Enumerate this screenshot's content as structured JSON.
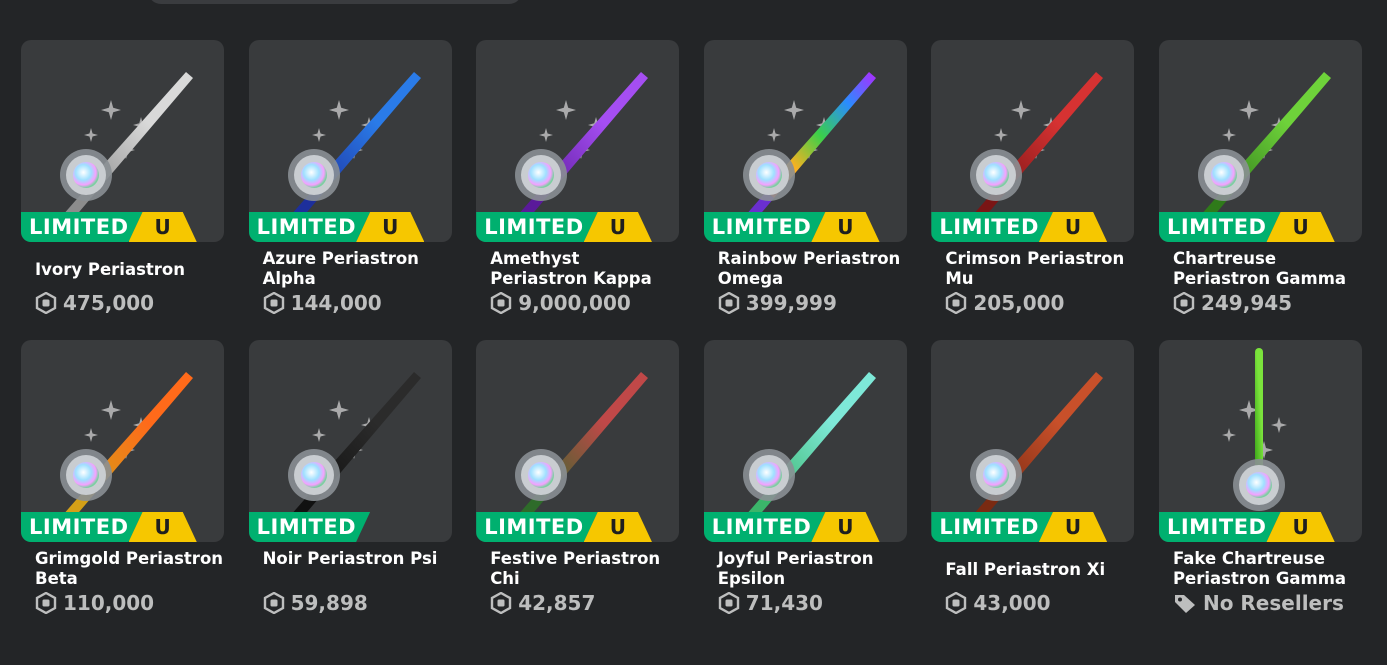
{
  "badges": {
    "limited": "LIMITED",
    "unique": "U"
  },
  "items": [
    {
      "name": "Ivory Periastron",
      "price": "475,000",
      "color": "#d9d9d9",
      "dark": "#8c8c8c",
      "limited_u": true,
      "sparkles": true
    },
    {
      "name": "Azure Periastron Alpha",
      "price": "144,000",
      "color": "#2a7be8",
      "dark": "#1d2f9c",
      "limited_u": true,
      "sparkles": true
    },
    {
      "name": "Amethyst Periastron Kappa",
      "price": "9,000,000",
      "color": "#a54ef2",
      "dark": "#5a1a9a",
      "limited_u": true,
      "sparkles": true
    },
    {
      "name": "Rainbow Periastron Omega",
      "price": "399,999",
      "color": "rainbow",
      "dark": "#6a2fd0",
      "limited_u": true,
      "sparkles": true
    },
    {
      "name": "Crimson Periastron Mu",
      "price": "205,000",
      "color": "#d63232",
      "dark": "#7a1515",
      "limited_u": true,
      "sparkles": true
    },
    {
      "name": "Chartreuse Periastron Gamma",
      "price": "249,945",
      "color": "#6ed23a",
      "dark": "#2f7a1a",
      "limited_u": true,
      "sparkles": true
    },
    {
      "name": "Grimgold Periastron Beta",
      "price": "110,000",
      "color": "#ff6a1a",
      "dark": "#d4a017",
      "limited_u": true,
      "sparkles": true
    },
    {
      "name": "Noir Periastron Psi",
      "price": "59,898",
      "color": "#2b2b2b",
      "dark": "#111111",
      "limited_u": false,
      "sparkles": true
    },
    {
      "name": "Festive Periastron Chi",
      "price": "42,857",
      "color": "#c04848",
      "dark": "#2e6b2a",
      "limited_u": true,
      "sparkles": false
    },
    {
      "name": "Joyful Periastron Epsilon",
      "price": "71,430",
      "color": "#7ee8d8",
      "dark": "#3bb56a",
      "limited_u": true,
      "sparkles": false
    },
    {
      "name": "Fall Periastron Xi",
      "price": "43,000",
      "color": "#c8502a",
      "dark": "#7a2a12",
      "limited_u": true,
      "sparkles": false
    },
    {
      "name": "Fake Chartreuse Periastron Gamma",
      "price": "No Resellers",
      "color": "#7be33c",
      "dark": "#3aa318",
      "limited_u": true,
      "sparkles": true,
      "no_resellers": true
    }
  ],
  "icons": {
    "currency": "robux-icon",
    "no_resellers": "tag-icon"
  }
}
